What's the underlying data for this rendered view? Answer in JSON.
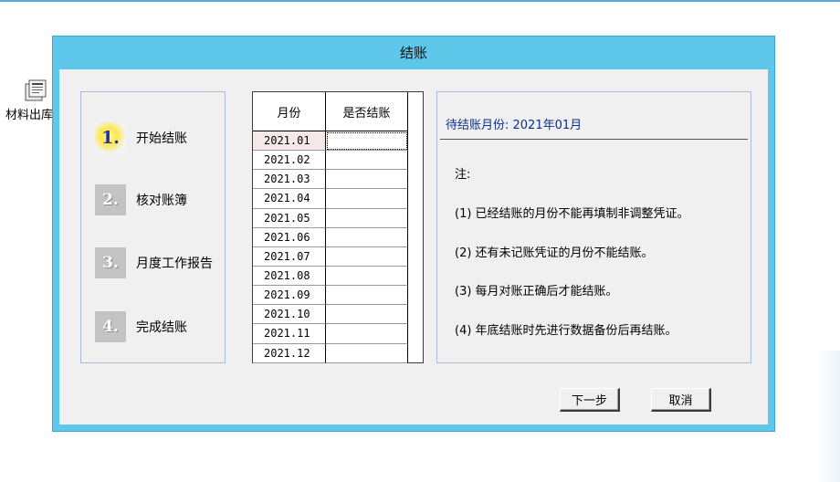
{
  "desktop": {
    "icon_name": "folder-document-icon",
    "label": "材料出库"
  },
  "dialog": {
    "title": "结账",
    "steps": [
      {
        "number": "1.",
        "label": "开始结账",
        "active": true
      },
      {
        "number": "2.",
        "label": "核对账簿",
        "active": false
      },
      {
        "number": "3.",
        "label": "月度工作报告",
        "active": false
      },
      {
        "number": "4.",
        "label": "完成结账",
        "active": false
      }
    ],
    "table": {
      "headers": [
        "月份",
        "是否结账"
      ],
      "rows": [
        {
          "month": "2021.01",
          "closed": ""
        },
        {
          "month": "2021.02",
          "closed": ""
        },
        {
          "month": "2021.03",
          "closed": ""
        },
        {
          "month": "2021.04",
          "closed": ""
        },
        {
          "month": "2021.05",
          "closed": ""
        },
        {
          "month": "2021.06",
          "closed": ""
        },
        {
          "month": "2021.07",
          "closed": ""
        },
        {
          "month": "2021.08",
          "closed": ""
        },
        {
          "month": "2021.09",
          "closed": ""
        },
        {
          "month": "2021.10",
          "closed": ""
        },
        {
          "month": "2021.11",
          "closed": ""
        },
        {
          "month": "2021.12",
          "closed": ""
        }
      ]
    },
    "info": {
      "pending_month": "待结账月份: 2021年01月",
      "note_title": "注:",
      "notes": [
        "(1) 已经结账的月份不能再填制非调整凭证。",
        "(2) 还有未记账凭证的月份不能结账。",
        "(3) 每月对账正确后才能结账。",
        "(4) 年底结账时先进行数据备份后再结账。"
      ]
    },
    "buttons": {
      "next": "下一步",
      "cancel": "取消"
    }
  },
  "colors": {
    "titlebar": "#5fc7ea",
    "client": "#f0f0f0",
    "pending_text": "#0b2d94",
    "active_step_number": "#1b2fa8"
  }
}
